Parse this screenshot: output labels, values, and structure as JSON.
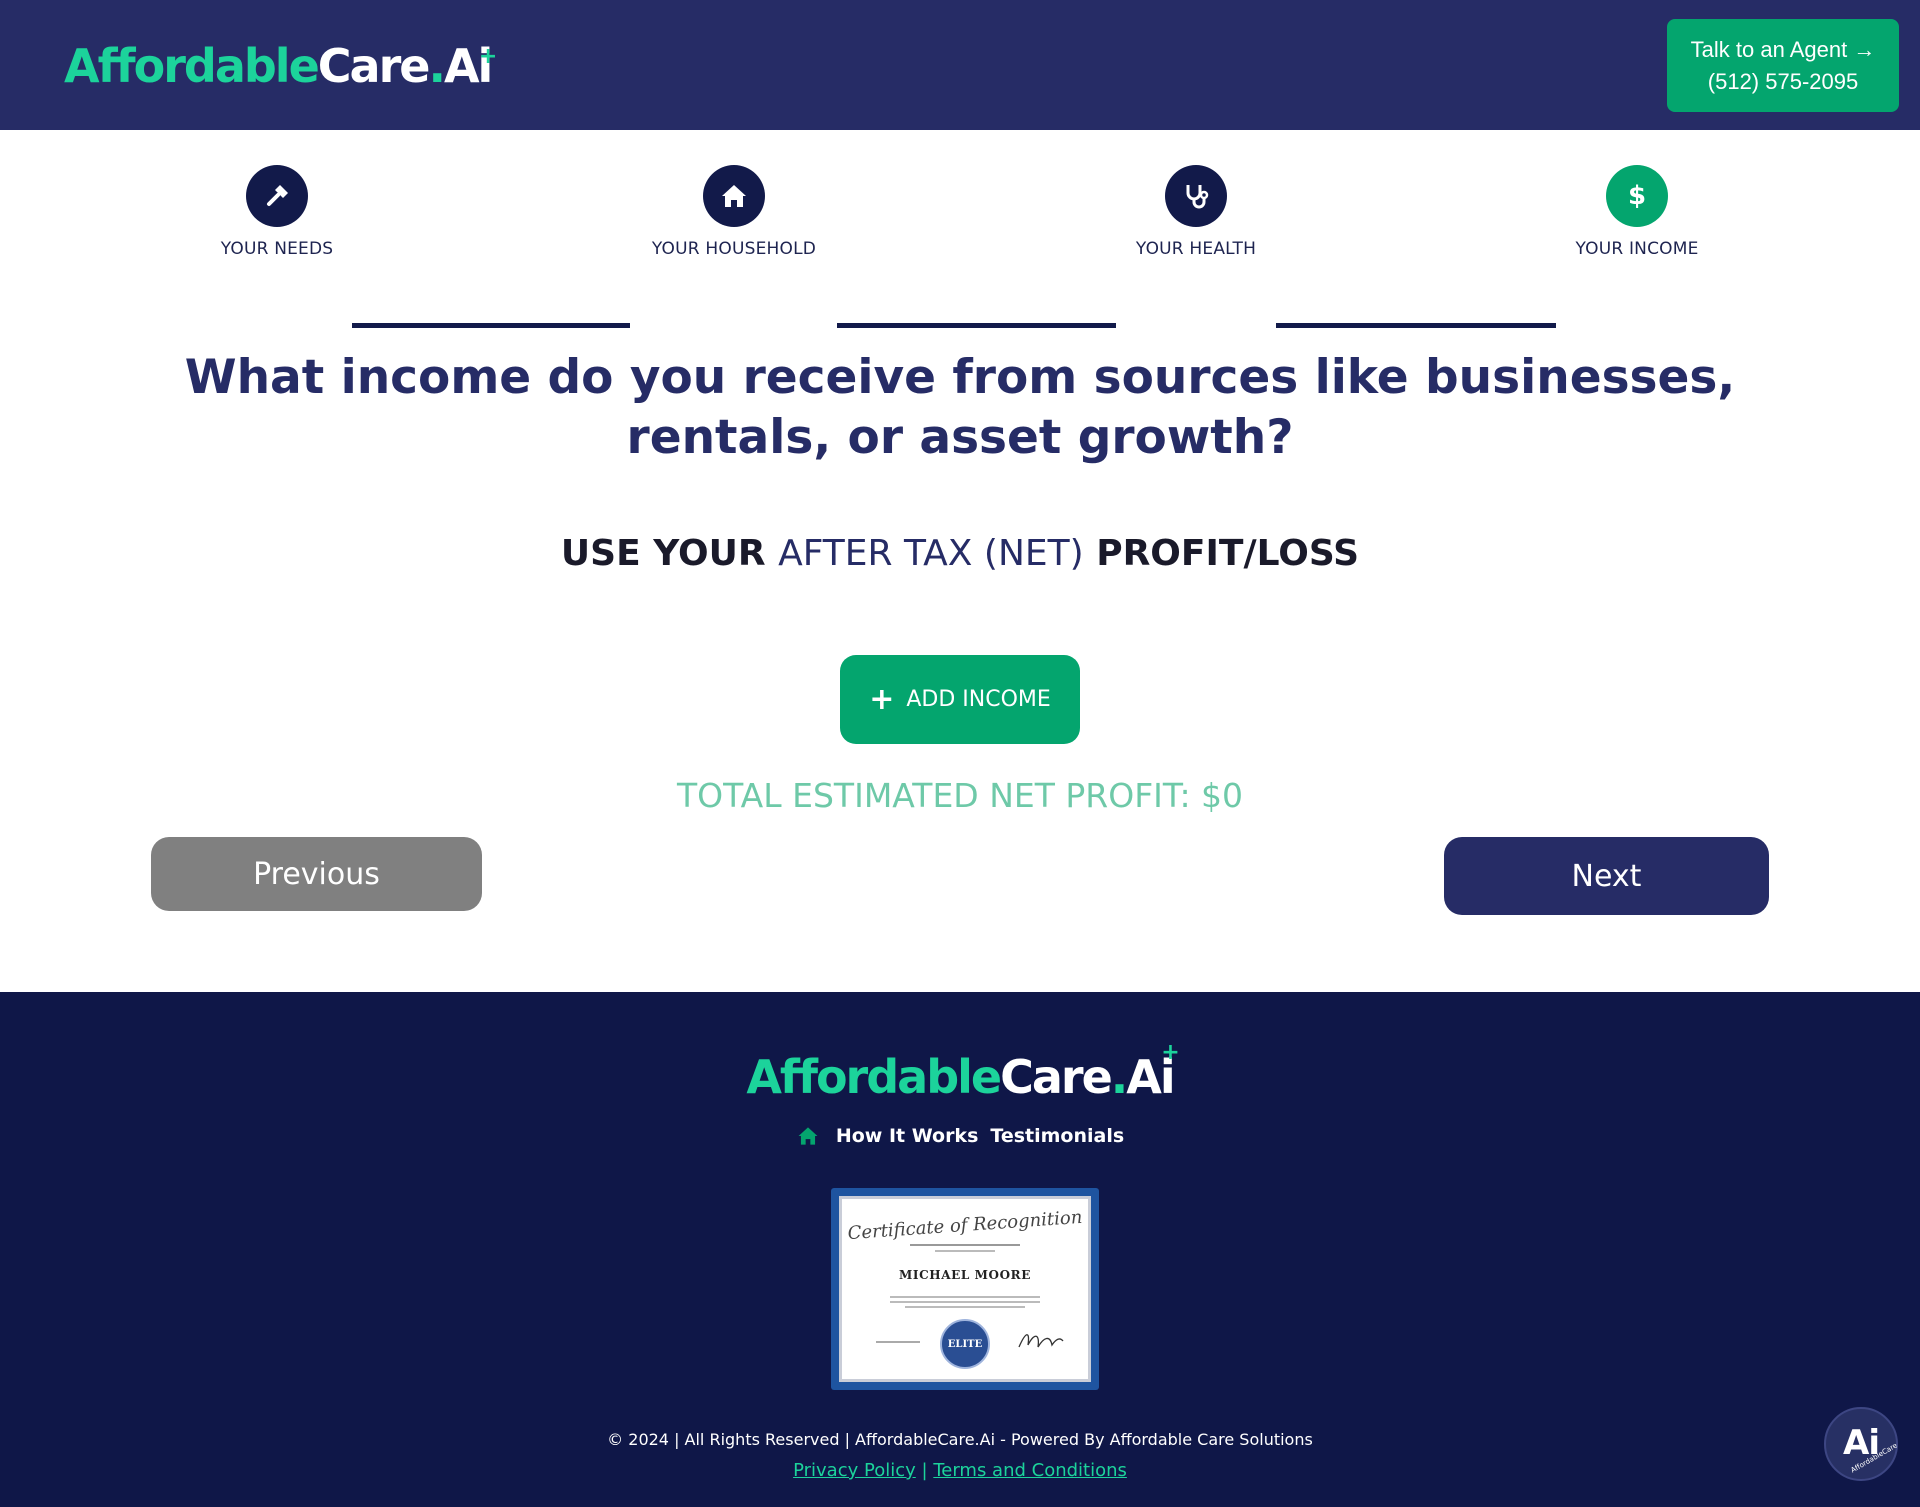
{
  "header": {
    "logo": {
      "part1": "Affordable",
      "part2": "Care",
      "dot": ".",
      "part3": "Ai",
      "plus": "+"
    },
    "agent_button": {
      "line1": "Talk to an Agent →",
      "line2": "(512) 575-2095"
    }
  },
  "stepper": {
    "steps": [
      {
        "label": "YOUR NEEDS",
        "icon": "hammer-icon",
        "active": false
      },
      {
        "label": "YOUR HOUSEHOLD",
        "icon": "home-icon",
        "active": false
      },
      {
        "label": "YOUR HEALTH",
        "icon": "stethoscope-icon",
        "active": false
      },
      {
        "label": "YOUR INCOME",
        "icon": "dollar-icon",
        "active": true
      }
    ]
  },
  "main": {
    "question_line1": "What income do you receive from sources like businesses,",
    "question_line2": "rentals, or asset growth?",
    "instruction": {
      "pre": "USE YOUR ",
      "highlight": "AFTER TAX (NET)",
      "post": " PROFIT/LOSS"
    },
    "add_income_label": "ADD INCOME",
    "total_label": "TOTAL ESTIMATED NET PROFIT: $0",
    "previous_label": "Previous",
    "next_label": "Next"
  },
  "footer": {
    "logo": {
      "part1": "Affordable",
      "part2": "Care",
      "dot": ".",
      "part3": "Ai",
      "plus": "+"
    },
    "nav": [
      "How It Works",
      "Testimonials"
    ],
    "certificate": {
      "title": "Certificate of Recognition",
      "name": "MICHAEL MOORE",
      "seal": "ELITE"
    },
    "copyright": "© 2024 | All Rights Reserved | AffordableCare.Ai - Powered By Affordable Care Solutions",
    "privacy_label": "Privacy Policy",
    "separator": "|",
    "terms_label": "Terms and Conditions",
    "badge": {
      "big": "Ai",
      "small": "AffordableCare"
    }
  },
  "colors": {
    "navy": "#262c66",
    "dark_navy": "#0f1748",
    "green": "#04a56e",
    "logo_green": "#1cd39b",
    "gray": "#808080"
  }
}
